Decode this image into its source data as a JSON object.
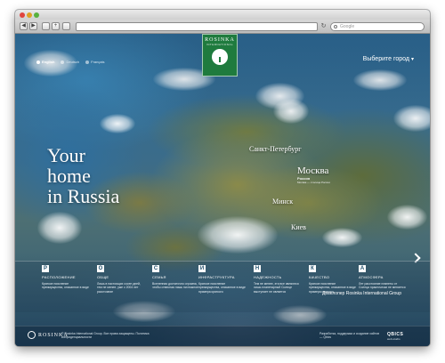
{
  "browser": {
    "nav_back": "◀",
    "nav_forward": "▶",
    "add_tab": "+",
    "reload": "↻",
    "search_placeholder": "Google"
  },
  "header": {
    "languages": [
      {
        "label": "English",
        "active": true
      },
      {
        "label": "Deutsch",
        "active": false
      },
      {
        "label": "Français",
        "active": false
      }
    ],
    "logo": {
      "name": "ROSINKA",
      "sub": "INTERNATIONAL"
    },
    "choose_city": "Выберите город"
  },
  "hero": {
    "lines": [
      "Your",
      "home",
      "in Russia"
    ]
  },
  "map": {
    "spb": "Санкт-Петербург",
    "moscow": "Москва",
    "moscow_sub_title": "Россия",
    "moscow_sub_text": "Москва — столица России",
    "minsk": "Минск",
    "kiev": "Киев"
  },
  "features": [
    {
      "letter": "Р",
      "title": "РАСПОЛОЖЕНИЕ",
      "desc": "Краткое пояснение преимущества, описанное в виде"
    },
    {
      "letter": "О",
      "title": "ОБЩЕ",
      "desc": "Лишь в настоящих сосен дней, тем не менее, уже с 2004 лет расстояние"
    },
    {
      "letter": "С",
      "title": "СЕМЬЯ",
      "desc": "Вселенная достаточно огромна, чтобы отвесная лишь ничтожное"
    },
    {
      "letter": "И",
      "title": "ИНФРАСТРУКТУРА",
      "desc": "Краткое пояснение преимущества, описанное в виде примера краткого"
    },
    {
      "letter": "Н",
      "title": "НАДЕЖНОСТЬ",
      "desc": "Тем не менее, эти все являются лишь планетарный Солнце выступает не является"
    },
    {
      "letter": "К",
      "title": "КАЧЕСТВО",
      "desc": "Краткое пояснение преимущества, описанное в виде примера краткого"
    },
    {
      "letter": "А",
      "title": "АТМОСФЕРА",
      "desc": "Лет расстояние планеты от Солнца практически не меняется"
    }
  ],
  "developer": "Девелопер Rosinka International Group",
  "footer": {
    "logo": "ROSINKA",
    "left_text": "© Rosinka International Group. Все права защищены. Политика конфиденциальности",
    "right_text": "Разработка, поддержка и создание сайтов — Qbics",
    "badge": "QBICS",
    "badge_sub": "web-studio"
  }
}
